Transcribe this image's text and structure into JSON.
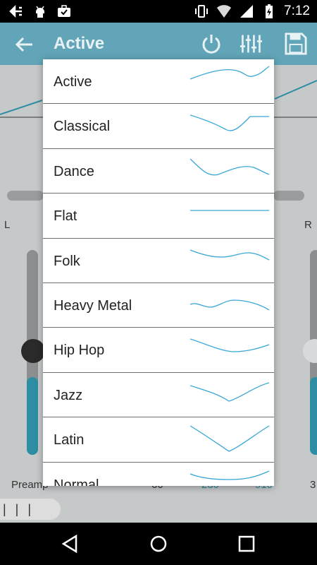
{
  "status_bar": {
    "time": "7:12",
    "left_icons": [
      "usb-debug-icon",
      "android-icon",
      "briefcase-check-icon"
    ],
    "right_icons": [
      "vibrate-icon",
      "wifi-icon",
      "signal-icon",
      "battery-charging-icon"
    ]
  },
  "app_bar": {
    "title": "Active",
    "actions": [
      "power-icon",
      "equalizer-sliders-icon",
      "save-icon"
    ]
  },
  "background": {
    "left_channel": "L",
    "right_channel": "R",
    "preamp_label": "Preamp",
    "freq_labels": [
      "60",
      "230",
      "910"
    ],
    "right_edge_label": "3",
    "accent_color": "#2d8ea3"
  },
  "presets": [
    {
      "label": "Active"
    },
    {
      "label": "Classical"
    },
    {
      "label": "Dance"
    },
    {
      "label": "Flat"
    },
    {
      "label": "Folk"
    },
    {
      "label": "Heavy Metal"
    },
    {
      "label": "Hip Hop"
    },
    {
      "label": "Jazz"
    },
    {
      "label": "Latin"
    },
    {
      "label": "Normal"
    }
  ],
  "curve_color": "#3aa7d6",
  "nav_bar": {
    "buttons": [
      "back-triangle-icon",
      "home-circle-icon",
      "recents-square-icon"
    ]
  }
}
